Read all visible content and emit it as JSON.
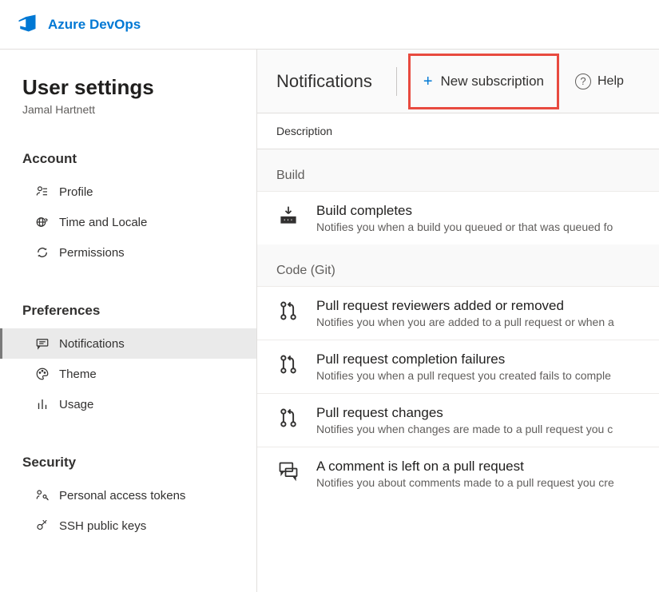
{
  "brand": "Azure DevOps",
  "page": {
    "title": "User settings",
    "username": "Jamal Hartnett"
  },
  "sidebar": {
    "sections": [
      {
        "header": "Account",
        "items": [
          {
            "label": "Profile",
            "icon": "profile-icon",
            "selected": false
          },
          {
            "label": "Time and Locale",
            "icon": "globe-icon",
            "selected": false
          },
          {
            "label": "Permissions",
            "icon": "refresh-icon",
            "selected": false
          }
        ]
      },
      {
        "header": "Preferences",
        "items": [
          {
            "label": "Notifications",
            "icon": "chat-icon",
            "selected": true
          },
          {
            "label": "Theme",
            "icon": "palette-icon",
            "selected": false
          },
          {
            "label": "Usage",
            "icon": "bar-chart-icon",
            "selected": false
          }
        ]
      },
      {
        "header": "Security",
        "items": [
          {
            "label": "Personal access tokens",
            "icon": "key-person-icon",
            "selected": false
          },
          {
            "label": "SSH public keys",
            "icon": "key-icon",
            "selected": false
          }
        ]
      }
    ]
  },
  "toolbar": {
    "title": "Notifications",
    "new_subscription_label": "New subscription",
    "help_label": "Help"
  },
  "columns": {
    "description": "Description"
  },
  "groups": [
    {
      "title": "Build",
      "items": [
        {
          "icon": "build-icon",
          "title": "Build completes",
          "desc": "Notifies you when a build you queued or that was queued fo"
        }
      ]
    },
    {
      "title": "Code (Git)",
      "items": [
        {
          "icon": "pr-icon",
          "title": "Pull request reviewers added or removed",
          "desc": "Notifies you when you are added to a pull request or when a"
        },
        {
          "icon": "pr-icon",
          "title": "Pull request completion failures",
          "desc": "Notifies you when a pull request you created fails to comple"
        },
        {
          "icon": "pr-icon",
          "title": "Pull request changes",
          "desc": "Notifies you when changes are made to a pull request you c"
        },
        {
          "icon": "comment-icon",
          "title": "A comment is left on a pull request",
          "desc": "Notifies you about comments made to a pull request you cre"
        }
      ]
    }
  ]
}
